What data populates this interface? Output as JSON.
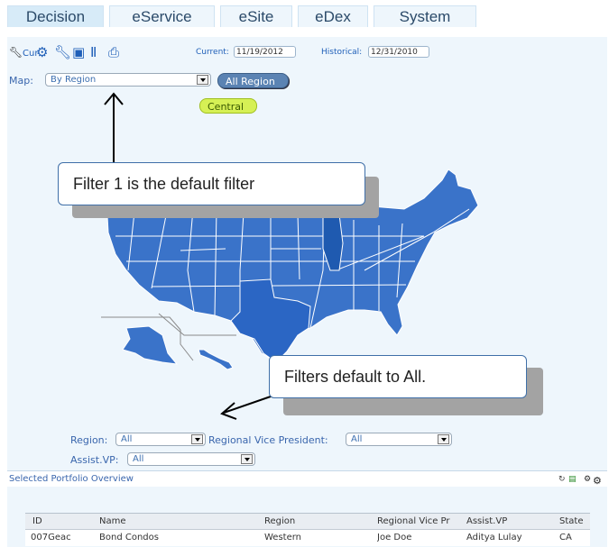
{
  "tabs": [
    {
      "label": "Decision",
      "active": true
    },
    {
      "label": "eService",
      "active": false
    },
    {
      "label": "eSite",
      "active": false
    },
    {
      "label": "eDex",
      "active": false
    },
    {
      "label": "System",
      "active": false
    }
  ],
  "toolbar": {
    "cur_label": "Cur",
    "current_label": "Current:",
    "current_value": "11/19/2012",
    "historical_label": "Historical:",
    "historical_value": "12/31/2010"
  },
  "map_filter": {
    "label": "Map:",
    "value": "By Region",
    "all_region_label": "All Region",
    "central_label": "Central"
  },
  "map_colors": {
    "region_fill": "#3a73c9",
    "highlight_fill": "#2b66c4",
    "border": "#ffffff"
  },
  "callouts": {
    "filter1": "Filter 1 is the default filter",
    "filters_all": "Filters default to All."
  },
  "filters": {
    "region_label": "Region:",
    "region_value": "All",
    "rvp_label": "Regional Vice President:",
    "rvp_value": "All",
    "avp_label": "Assist.VP:",
    "avp_value": "All"
  },
  "portfolio": {
    "title": "Selected Portfolio Overview",
    "columns": [
      "ID",
      "Name",
      "Region",
      "Regional Vice Pr",
      "Assist.VP",
      "State"
    ],
    "rows": [
      [
        "007Geac",
        "Bond Condos",
        "Western",
        "Joe Doe",
        "Aditya Lulay",
        "CA"
      ]
    ]
  }
}
